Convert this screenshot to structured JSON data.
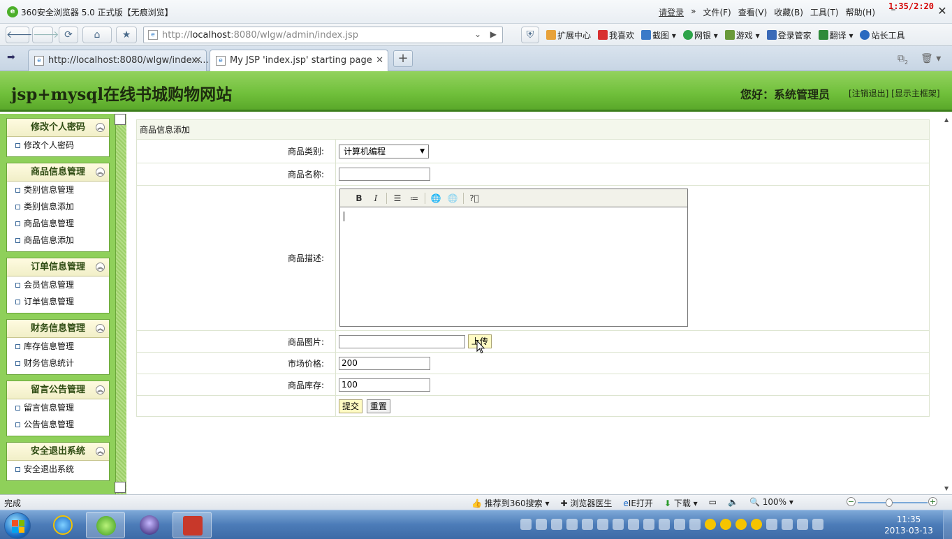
{
  "browser": {
    "title": "360安全浏览器 5.0 正式版【无痕浏览】",
    "menu": {
      "login": "请登录",
      "file": "文件(F)",
      "view": "查看(V)",
      "favorites": "收藏(B)",
      "tools": "工具(T)",
      "help": "帮助(H)"
    },
    "overlay_clock": "1:35/2:20",
    "address": {
      "prefix": "http://",
      "host": "localhost",
      "rest": ":8080/wlgw/admin/index.jsp"
    },
    "toolbar": {
      "extensions": "扩展中心",
      "favorites_like": "我喜欢",
      "screenshot": "截图",
      "bank": "网银",
      "games": "游戏",
      "login_manager": "登录管家",
      "translate": "翻译",
      "webmaster": "站长工具"
    },
    "tabs": [
      {
        "label": "http://localhost:8080/wlgw/index...."
      },
      {
        "label": "My JSP 'index.jsp' starting page"
      }
    ],
    "tab_count_badge": "2"
  },
  "page": {
    "site_title": "jsp+mysql在线书城购物网站",
    "greeting": "您好：系统管理员",
    "links": "[注销退出] [显示主框架]"
  },
  "sidebar": {
    "groups": [
      {
        "title": "修改个人密码",
        "items": [
          "修改个人密码"
        ]
      },
      {
        "title": "商品信息管理",
        "items": [
          "类别信息管理",
          "类别信息添加",
          "商品信息管理",
          "商品信息添加"
        ]
      },
      {
        "title": "订单信息管理",
        "items": [
          "会员信息管理",
          "订单信息管理"
        ]
      },
      {
        "title": "财务信息管理",
        "items": [
          "库存信息管理",
          "财务信息统计"
        ]
      },
      {
        "title": "留言公告管理",
        "items": [
          "留言信息管理",
          "公告信息管理"
        ]
      },
      {
        "title": "安全退出系统",
        "items": [
          "安全退出系统"
        ]
      }
    ]
  },
  "form": {
    "caption": "商品信息添加",
    "category_label": "商品类别:",
    "category_value": "计算机编程",
    "name_label": "商品名称:",
    "name_value": "",
    "desc_label": "商品描述:",
    "image_label": "商品图片:",
    "image_value": "",
    "upload_button": "上传",
    "market_price_label": "市场价格:",
    "market_price_value": "200",
    "stock_label": "商品库存:",
    "stock_value": "100",
    "submit_button": "提交",
    "reset_button": "重置"
  },
  "editor_toolbar": [
    "B",
    "I"
  ],
  "status": {
    "left": "完成",
    "recommend": "推荐到360搜索",
    "doctor": "浏览器医生",
    "ie_open": "IE打开",
    "download": "下载",
    "zoom": "100%"
  },
  "taskbar": {
    "time": "11:35",
    "date": "2013-03-13"
  }
}
